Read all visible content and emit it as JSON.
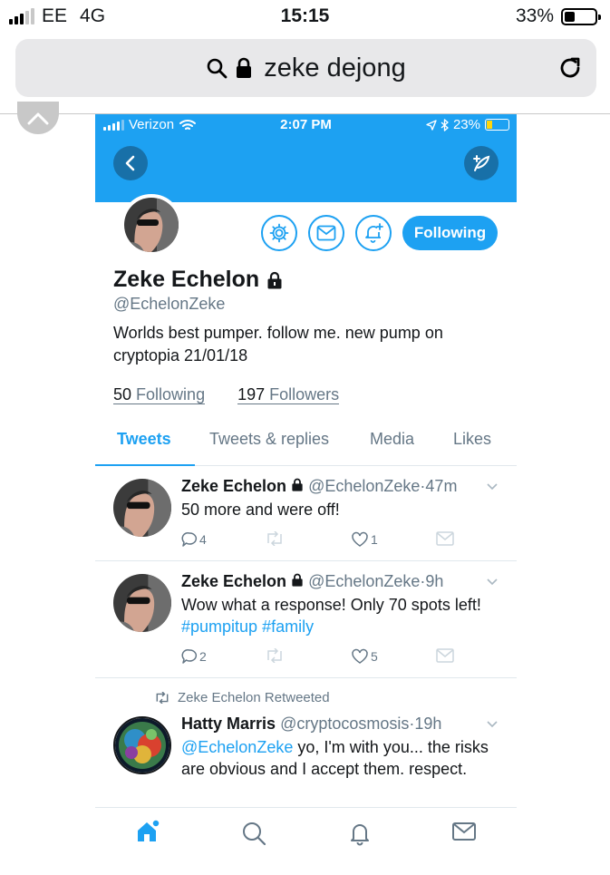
{
  "os_status": {
    "carrier": "EE",
    "network": "4G",
    "time": "15:15",
    "battery": "33%",
    "battery_level": 0.33
  },
  "browser": {
    "url_text": "zeke dejong"
  },
  "app_status": {
    "carrier": "Verizon",
    "time": "2:07 PM",
    "battery": "23%"
  },
  "profile": {
    "name": "Zeke Echelon",
    "handle": "@EchelonZeke",
    "bio": "Worlds best pumper. follow me. new pump on cryptopia 21/01/18",
    "following_count": "50",
    "following_label": "Following",
    "followers_count": "197",
    "followers_label": "Followers",
    "follow_button": "Following"
  },
  "tabs": [
    {
      "label": "Tweets",
      "active": true
    },
    {
      "label": "Tweets & replies",
      "active": false
    },
    {
      "label": "Media",
      "active": false
    },
    {
      "label": "Likes",
      "active": false
    }
  ],
  "tweets": [
    {
      "name": "Zeke Echelon",
      "handle": "@EchelonZeke",
      "time": "47m",
      "text": "50 more and were off!",
      "replies": "4",
      "likes": "1"
    },
    {
      "name": "Zeke Echelon",
      "handle": "@EchelonZeke",
      "time": "9h",
      "text_plain": "Wow what a response! Only 70 spots left!",
      "hashtags": [
        "#pumpitup",
        "#family"
      ],
      "replies": "2",
      "likes": "5"
    },
    {
      "retweet_label": "Zeke Echelon Retweeted",
      "name": "Hatty Marris",
      "handle": "@cryptocosmosis",
      "time": "19h",
      "mention": "@EchelonZeke",
      "text_rest": "yo, I'm with you... the risks are obvious and I accept them. respect."
    }
  ],
  "separator": "·",
  "colors": {
    "accent": "#1da1f2",
    "secondary_text": "#657786",
    "divider": "#e1e8ed"
  },
  "bottom_tabs": [
    "home-icon",
    "search-icon",
    "notifications-icon",
    "messages-icon"
  ]
}
